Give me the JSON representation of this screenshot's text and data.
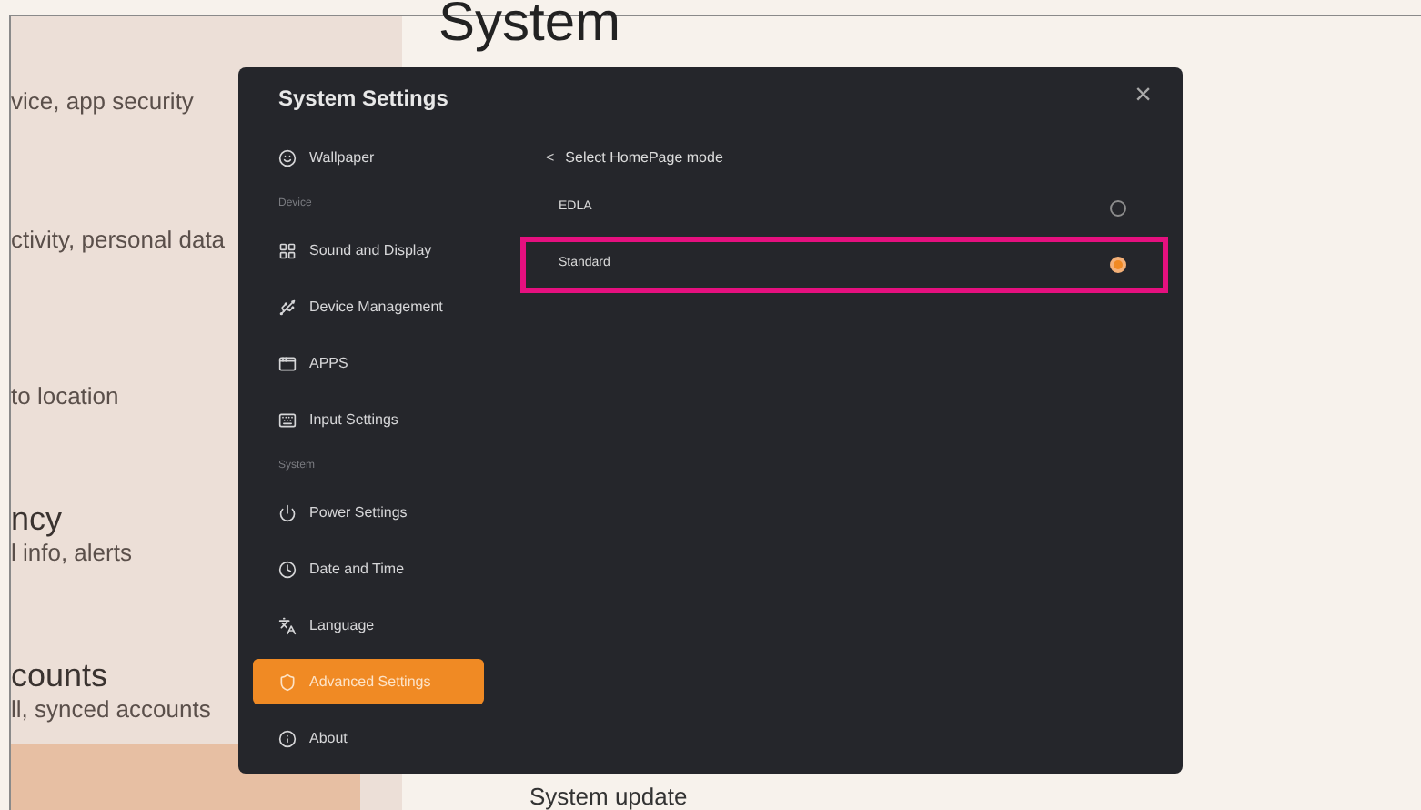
{
  "background": {
    "page_title": "System",
    "left_groups": [
      {
        "subtitle": "vice, app security"
      },
      {
        "subtitle": "ctivity, personal data"
      },
      {
        "subtitle": "to location"
      },
      {
        "heading": "ncy",
        "subtitle": "l info, alerts"
      },
      {
        "heading": "counts",
        "subtitle": "ll, synced accounts"
      }
    ],
    "footer_item": "System update"
  },
  "dialog": {
    "title": "System Settings",
    "close": "×",
    "nav": [
      {
        "kind": "item",
        "label": "Wallpaper",
        "selected": false
      },
      {
        "kind": "section",
        "label": "Device"
      },
      {
        "kind": "item",
        "label": "Sound and Display",
        "selected": false
      },
      {
        "kind": "item",
        "label": "Device Management",
        "selected": false
      },
      {
        "kind": "item",
        "label": "APPS",
        "selected": false
      },
      {
        "kind": "item",
        "label": "Input Settings",
        "selected": false
      },
      {
        "kind": "section",
        "label": "System"
      },
      {
        "kind": "item",
        "label": "Power Settings",
        "selected": false
      },
      {
        "kind": "item",
        "label": "Date and Time",
        "selected": false
      },
      {
        "kind": "item",
        "label": "Language",
        "selected": false
      },
      {
        "kind": "item",
        "label": "Advanced Settings",
        "selected": true
      },
      {
        "kind": "item",
        "label": "About",
        "selected": false
      }
    ],
    "content": {
      "back": "<",
      "heading": "Select HomePage mode",
      "options": [
        {
          "label": "EDLA",
          "selected": false,
          "highlighted": false
        },
        {
          "label": "Standard",
          "selected": true,
          "highlighted": true
        }
      ]
    }
  }
}
